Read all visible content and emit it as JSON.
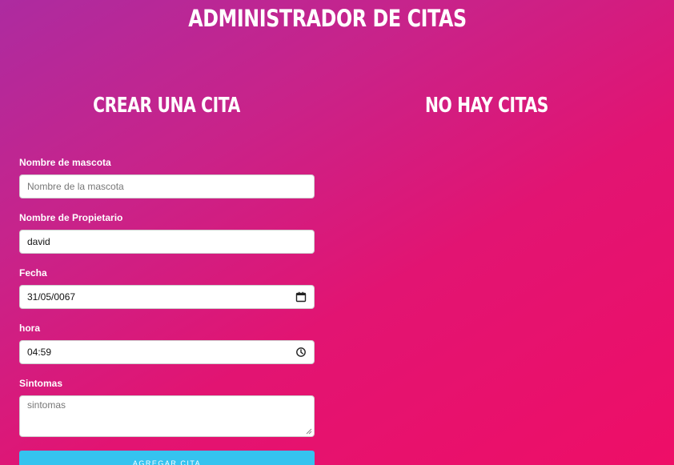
{
  "header": {
    "title": "ADMINISTRADOR DE CITAS"
  },
  "form": {
    "title": "CREAR UNA CITA",
    "pet_label": "Nombre de mascota",
    "pet_placeholder": "Nombre de la mascota",
    "pet_value": "",
    "owner_label": "Nombre de Propietario",
    "owner_value": "david",
    "date_label": "Fecha",
    "date_value": "31/05/0067",
    "time_label": "hora",
    "time_value": "04:59",
    "symptoms_label": "Sintomas",
    "symptoms_placeholder": "sintomas",
    "submit_label": "AGREGAR CITA"
  },
  "appointments": {
    "title": "NO HAY CITAS"
  },
  "icons": {
    "date": "calendar-icon",
    "time": "clock-icon"
  },
  "colors": {
    "button": "#35c3ef",
    "gradient_start": "#ad2ba0",
    "gradient_end": "#ee0e67"
  }
}
